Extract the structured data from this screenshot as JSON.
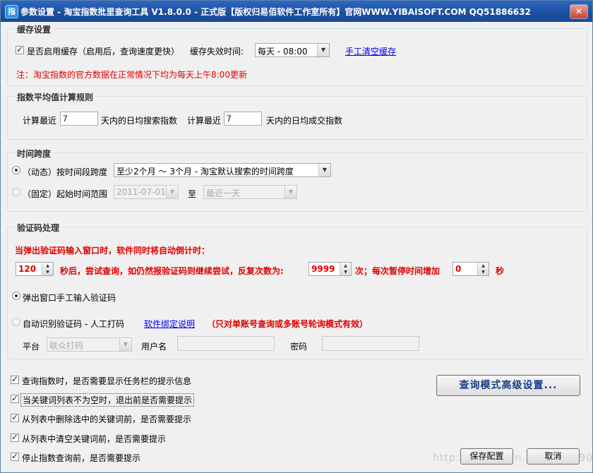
{
  "window": {
    "title": "参数设置 - 淘宝指数批里查询工具 V1.8.0.0 - 正式版【版权归易佰软件工作室所有】官网WWW.YIBAISOFT.COM QQ51886632",
    "icon_glyph": "指",
    "close_glyph": "✕"
  },
  "cache": {
    "group_title": "缓存设置",
    "enable_label": "是否启用缓存（启用后，查询速度更快）",
    "expire_label": "缓存失效时间:",
    "expire_value": "每天 - 08:00",
    "clear_link": "手工清空缓存",
    "note": "注：淘宝指数的官方数据在正常情况下均为每天上午8:00更新"
  },
  "average": {
    "group_title": "指数平均值计算规则",
    "recent_label_1": "计算最近",
    "search_days": "7",
    "search_suffix": "天内的日均搜索指数",
    "recent_label_2": "计算最近",
    "deal_days": "7",
    "deal_suffix": "天内的日均成交指数"
  },
  "timespan": {
    "group_title": "时间跨度",
    "dynamic_label": "（动态）按时间段跨度",
    "dynamic_value": "至少2个月 ～ 3个月 -  淘宝默认搜索的时间跨度",
    "fixed_label": "（固定）起始时间范围",
    "fixed_start": "2011-07-01",
    "to_label": "至",
    "fixed_end": "最近一天"
  },
  "captcha": {
    "group_title": "验证码处理",
    "headline": "当弹出验证码输入窗口时，软件同时将自动倒计时：",
    "seconds_value": "120",
    "retry_text": "秒后，尝试查询，如仍然报验证码则继续尝试，反复次数为:",
    "repeat_value": "9999",
    "increase_text": "次；每次暂停时间增加",
    "increase_value": "0",
    "sec_unit": "秒",
    "manual_label": "弹出窗口手工输入验证码",
    "auto_label": "自动识别验证码 - 人工打码",
    "bind_link": "软件绑定说明",
    "auto_note": "（只对单账号查询或多账号轮询模式有效）",
    "platform_label": "平台",
    "platform_value": "联众打码",
    "username_label": "用户名",
    "password_label": "密码"
  },
  "options": [
    "查询指数时，是否需要显示任务栏的提示信息",
    "当关键词列表不为空时，退出前是否需要提示",
    "从列表中删除选中的关键词前，是否需要提示",
    "从列表中清空关键词前，是否需要提示",
    "停止指数查询前，是否需要提示"
  ],
  "buttons": {
    "advanced": "查询模式高级设置...",
    "save": "保存配置",
    "cancel": "取消"
  },
  "watermark": "http://blog.csdn.net/xiuu990"
}
